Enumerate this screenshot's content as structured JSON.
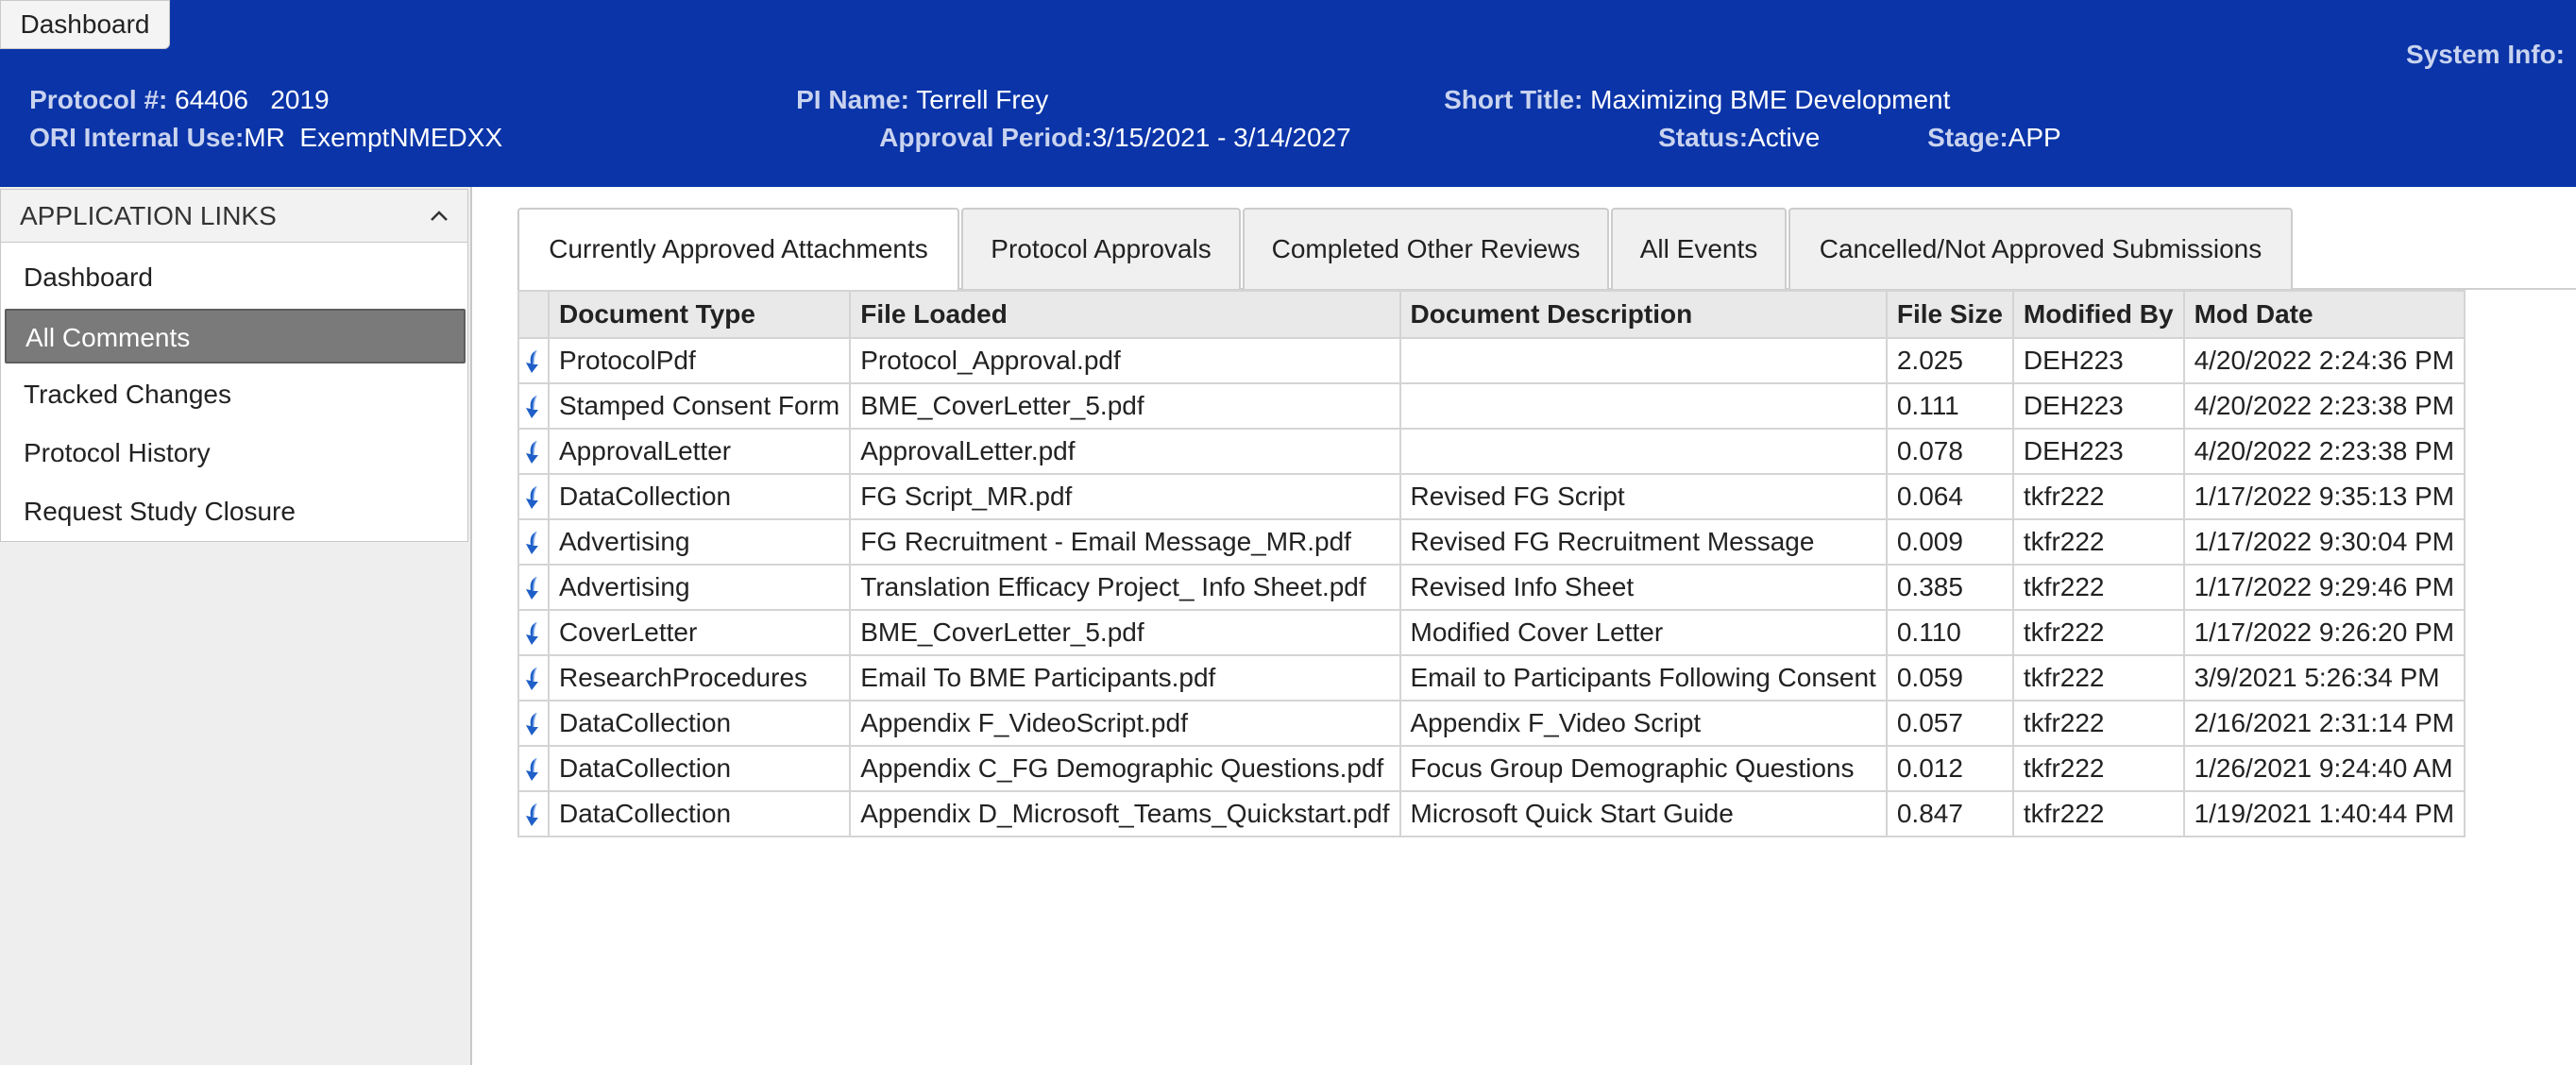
{
  "header": {
    "dashboard_button": "Dashboard",
    "protocol_label": "Protocol #:",
    "protocol_value": " 64406   2019",
    "pi_label": "PI Name:",
    "pi_value": " Terrell Frey",
    "short_title_label": "Short Title:",
    "short_title_value": " Maximizing BME Development",
    "system_info_label": "System Info:",
    "ori_label": "ORI Internal Use:",
    "ori_value": "MR  ExemptNMEDXX",
    "approval_label": "Approval Period:",
    "approval_value": "3/15/2021 - 3/14/2027",
    "status_label": "Status:",
    "status_value": "Active",
    "stage_label": "Stage:",
    "stage_value": "APP"
  },
  "sidebar": {
    "title": "APPLICATION LINKS",
    "items": [
      {
        "label": "Dashboard",
        "active": false
      },
      {
        "label": "All Comments",
        "active": true
      },
      {
        "label": "Tracked Changes",
        "active": false
      },
      {
        "label": "Protocol History",
        "active": false
      },
      {
        "label": "Request Study Closure",
        "active": false
      }
    ]
  },
  "tabs": [
    {
      "label": "Currently Approved Attachments",
      "active": true
    },
    {
      "label": "Protocol Approvals",
      "active": false
    },
    {
      "label": "Completed Other Reviews",
      "active": false
    },
    {
      "label": "All Events",
      "active": false
    },
    {
      "label": "Cancelled/Not Approved Submissions",
      "active": false
    }
  ],
  "table": {
    "columns": [
      "",
      "Document Type",
      "File Loaded",
      "Document Description",
      "File Size",
      "Modified By",
      "Mod Date"
    ],
    "rows": [
      [
        "ProtocolPdf",
        "Protocol_Approval.pdf",
        "",
        "2.025",
        "DEH223",
        "4/20/2022 2:24:36 PM"
      ],
      [
        "Stamped Consent Form",
        "BME_CoverLetter_5.pdf",
        "",
        "0.111",
        "DEH223",
        "4/20/2022 2:23:38 PM"
      ],
      [
        "ApprovalLetter",
        "ApprovalLetter.pdf",
        "",
        "0.078",
        "DEH223",
        "4/20/2022 2:23:38 PM"
      ],
      [
        "DataCollection",
        "FG Script_MR.pdf",
        "Revised FG Script",
        "0.064",
        "tkfr222",
        "1/17/2022 9:35:13 PM"
      ],
      [
        "Advertising",
        "FG Recruitment - Email Message_MR.pdf",
        "Revised FG Recruitment Message",
        "0.009",
        "tkfr222",
        "1/17/2022 9:30:04 PM"
      ],
      [
        "Advertising",
        "Translation Efficacy Project_ Info Sheet.pdf",
        "Revised Info Sheet",
        "0.385",
        "tkfr222",
        "1/17/2022 9:29:46 PM"
      ],
      [
        "CoverLetter",
        "BME_CoverLetter_5.pdf",
        "Modified Cover Letter",
        "0.110",
        "tkfr222",
        "1/17/2022 9:26:20 PM"
      ],
      [
        "ResearchProcedures",
        "Email To BME Participants.pdf",
        "Email to Participants Following Consent",
        "0.059",
        "tkfr222",
        "3/9/2021 5:26:34 PM"
      ],
      [
        "DataCollection",
        "Appendix F_VideoScript.pdf",
        "Appendix F_Video Script",
        "0.057",
        "tkfr222",
        "2/16/2021 2:31:14 PM"
      ],
      [
        "DataCollection",
        "Appendix C_FG Demographic Questions.pdf",
        "Focus Group Demographic Questions",
        "0.012",
        "tkfr222",
        "1/26/2021 9:24:40 AM"
      ],
      [
        "DataCollection",
        "Appendix D_Microsoft_Teams_Quickstart.pdf",
        "Microsoft Quick Start Guide",
        "0.847",
        "tkfr222",
        "1/19/2021 1:40:44 PM"
      ]
    ],
    "row_icon": "download-arrow-icon"
  },
  "colors": {
    "header_bg": "#0a34a8",
    "header_label": "#c9d3ef",
    "active_sidebar_item": "#7a7a7a",
    "icon_blue": "#1f5fc7"
  }
}
